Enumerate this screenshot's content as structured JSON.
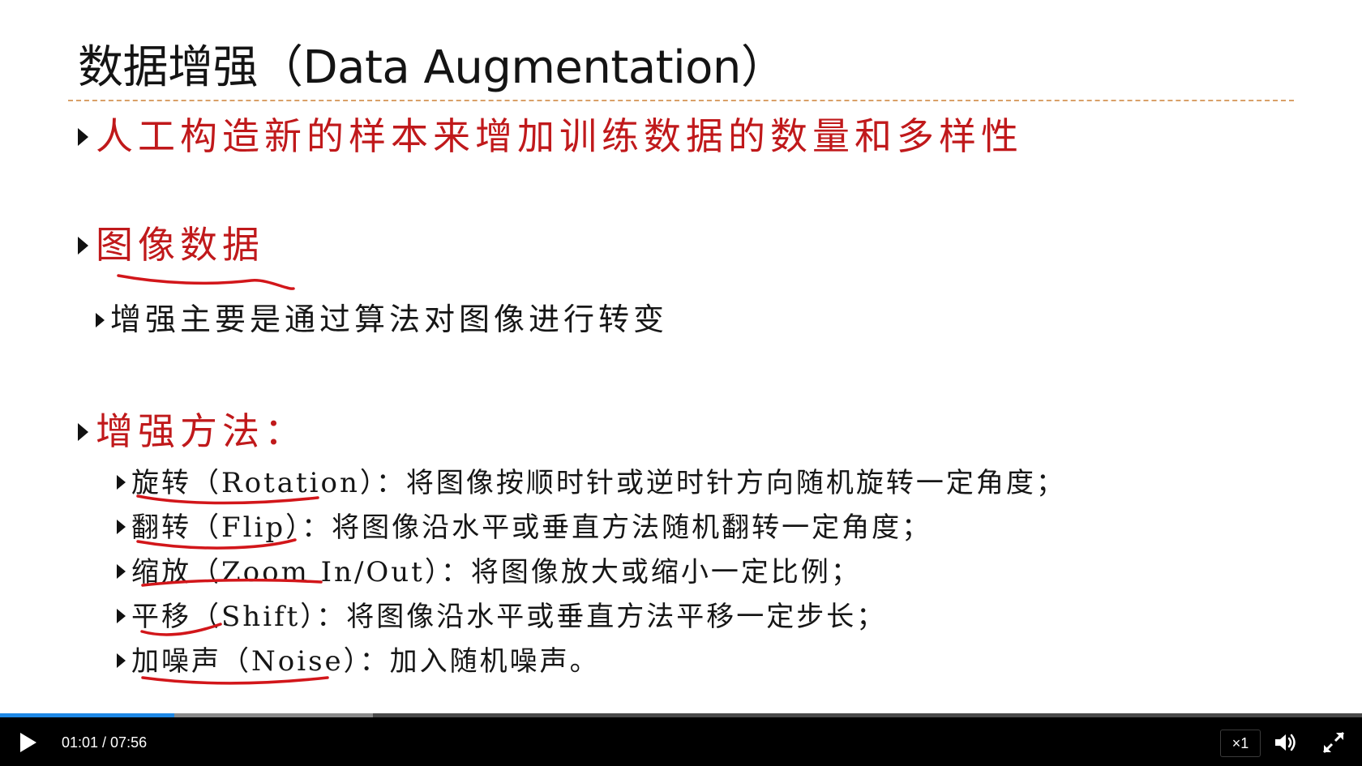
{
  "slide": {
    "title": "数据增强（Data Augmentation）",
    "bullet1": "人工构造新的样本来增加训练数据的数量和多样性",
    "bullet2": "图像数据",
    "bullet2_sub": "增强主要是通过算法对图像进行转变",
    "bullet3": "增强方法：",
    "methods": [
      "旋转（Rotation）：将图像按顺时针或逆时针方向随机旋转一定角度；",
      "翻转（Flip）：将图像沿水平或垂直方法随机翻转一定角度；",
      "缩放（Zoom In/Out）：将图像放大或缩小一定比例；",
      "平移（Shift）：将图像沿水平或垂直方法平移一定步长；",
      "加噪声（Noise）：加入随机噪声。"
    ],
    "colors": {
      "accent_text": "#c0191b",
      "annotation_ink": "#d2161a",
      "title_rule": "#d9a068"
    }
  },
  "player": {
    "current_time": "01:01",
    "time_separator": "/",
    "duration": "07:56",
    "time_display": "01:01 / 07:56",
    "playback_rate": "×1",
    "played_fraction": 0.128,
    "buffered_fraction": 0.274,
    "icons": {
      "play": "play-icon",
      "volume": "volume-icon",
      "fullscreen": "fullscreen-icon"
    },
    "colors": {
      "progress_played": "#1e88e5",
      "progress_buffered": "#8a8a8a",
      "bar_background": "#000000"
    }
  }
}
